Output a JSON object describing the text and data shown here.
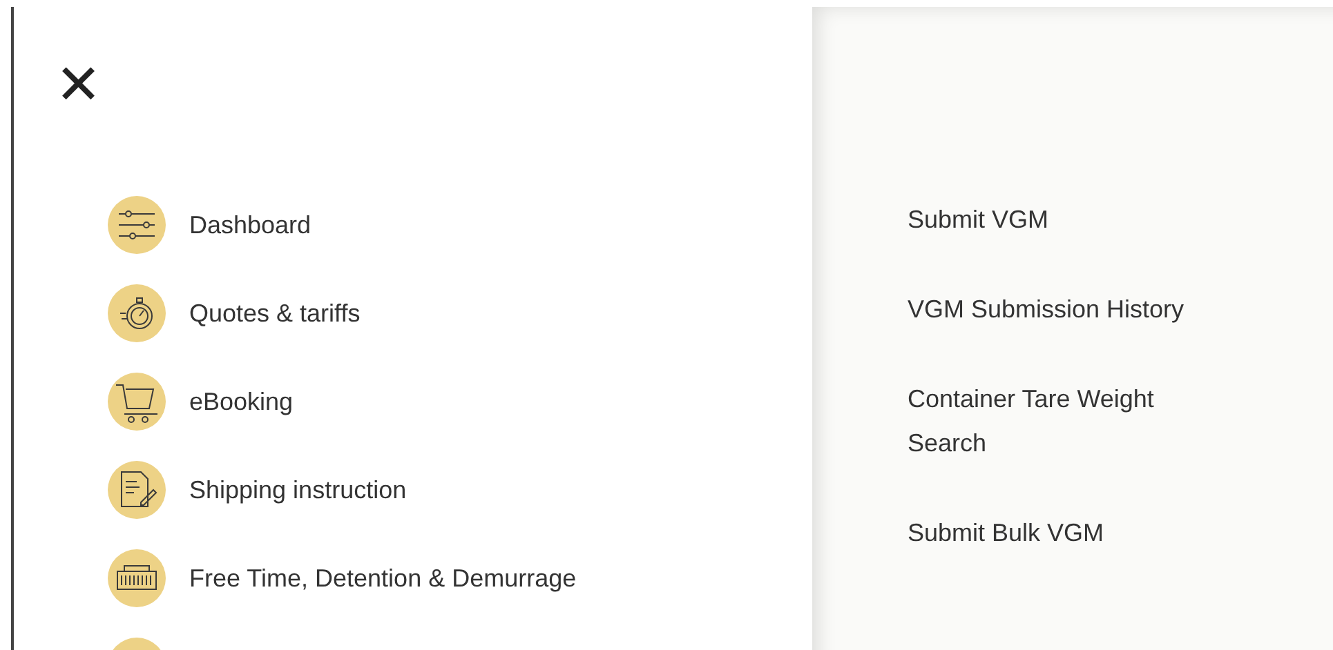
{
  "close_button": {
    "glyph": "✕"
  },
  "main_menu": [
    {
      "kind": "entry",
      "label": "Dashboard"
    },
    {
      "kind": "entry",
      "label": "Quotes & tariffs"
    },
    {
      "kind": "entry",
      "label": "eBooking"
    },
    {
      "kind": "entry",
      "label": "Shipping instruction"
    },
    {
      "kind": "entry",
      "label": "Free Time, Detention & Demurrage"
    },
    {
      "kind": "cut_off"
    }
  ],
  "submenu": [
    {
      "label": "Submit VGM"
    },
    {
      "label": "VGM Submission History"
    },
    {
      "label": "Container Tare Weight Search"
    },
    {
      "label": "Submit Bulk VGM"
    }
  ]
}
